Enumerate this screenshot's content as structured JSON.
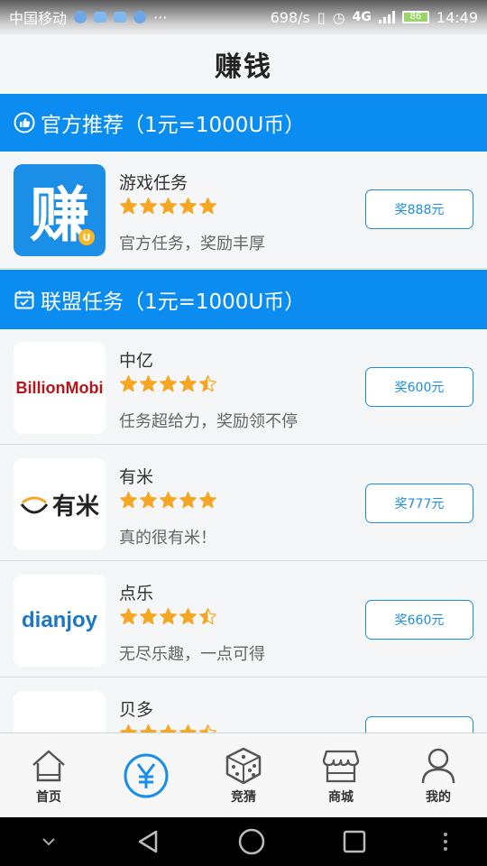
{
  "status_bar": {
    "carrier": "中国移动",
    "speed": "698/s",
    "network": "4G",
    "battery": "86",
    "time": "14:49"
  },
  "page_title": "赚钱",
  "sections": {
    "official": {
      "title": "官方推荐（1元=1000U币）"
    },
    "alliance": {
      "title": "联盟任务（1元=1000U币）"
    }
  },
  "items": [
    {
      "logo_text": "赚",
      "name": "游戏任务",
      "rating": 5,
      "desc": "官方任务，奖励丰厚",
      "reward": "奖888元"
    },
    {
      "logo_text": "BillionMobi",
      "name": "中亿",
      "rating": 4.5,
      "desc": "任务超给力，奖励领不停",
      "reward": "奖600元"
    },
    {
      "logo_text": "有米",
      "name": "有米",
      "rating": 5,
      "desc": "真的很有米！",
      "reward": "奖777元"
    },
    {
      "logo_text": "dianjoy",
      "name": "点乐",
      "rating": 4.5,
      "desc": "无尽乐趣，一点可得",
      "reward": "奖660元"
    },
    {
      "logo_text": "",
      "name": "贝多",
      "rating": 4.5,
      "desc": "",
      "reward": ""
    }
  ],
  "tabs": [
    {
      "label": "首页",
      "icon": "home-icon"
    },
    {
      "label": "",
      "icon": "yuan-icon"
    },
    {
      "label": "竞猜",
      "icon": "dice-icon"
    },
    {
      "label": "商城",
      "icon": "store-icon"
    },
    {
      "label": "我的",
      "icon": "person-icon"
    }
  ],
  "colors": {
    "accent": "#0b8cf0",
    "star": "#f5a623",
    "button_border": "#1a8de8"
  }
}
